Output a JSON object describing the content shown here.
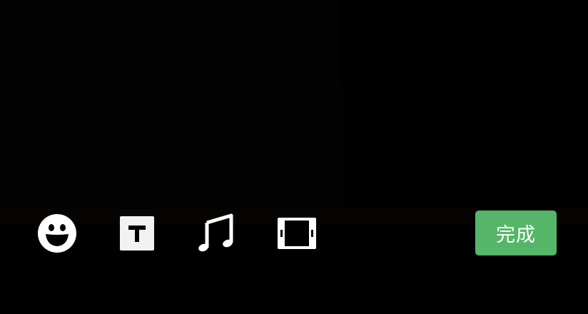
{
  "toolbar": {
    "tools": [
      {
        "name": "emoji",
        "icon": "smiley-face-icon"
      },
      {
        "name": "text",
        "icon": "text-t-icon"
      },
      {
        "name": "music",
        "icon": "music-note-icon"
      },
      {
        "name": "clip",
        "icon": "film-frame-icon"
      }
    ],
    "done_label": "完成"
  },
  "colors": {
    "background": "#000000",
    "icon": "#ffffff",
    "done_button": "#55b66a"
  }
}
